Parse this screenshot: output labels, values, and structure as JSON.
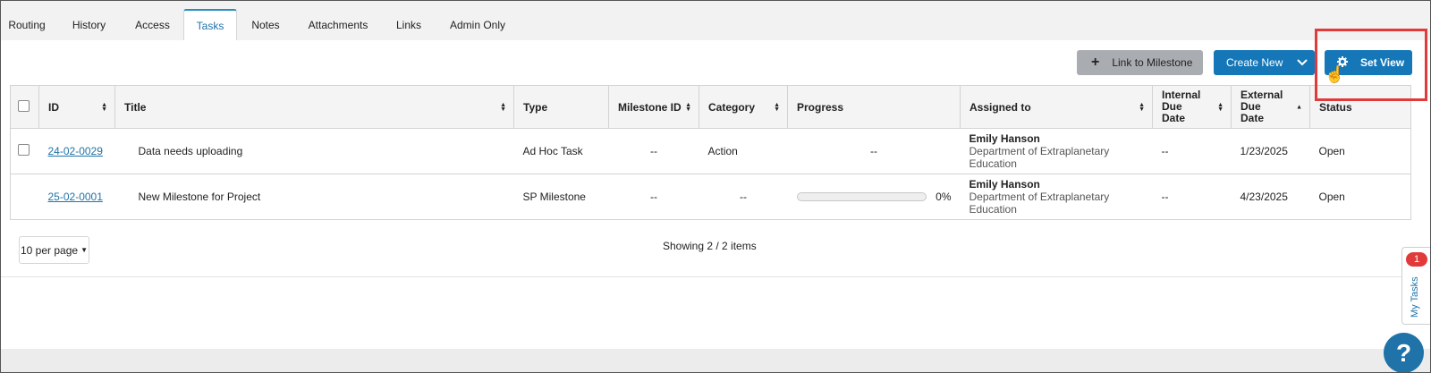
{
  "tabs": [
    {
      "label": "Routing"
    },
    {
      "label": "History"
    },
    {
      "label": "Access"
    },
    {
      "label": "Tasks"
    },
    {
      "label": "Notes"
    },
    {
      "label": "Attachments"
    },
    {
      "label": "Links"
    },
    {
      "label": "Admin Only"
    }
  ],
  "active_tab": "Tasks",
  "toolbar": {
    "link_label": "Link to Milestone",
    "create_label": "Create New",
    "setview_label": "Set View"
  },
  "table": {
    "headers": {
      "id": "ID",
      "title": "Title",
      "type": "Type",
      "milestone_id": "Milestone ID",
      "category": "Category",
      "progress": "Progress",
      "assigned": "Assigned to",
      "internal_due": "Internal Due Date",
      "external_due": "External Due Date",
      "status": "Status"
    },
    "rows": [
      {
        "id": "24-02-0029",
        "title": "Data needs uploading",
        "type": "Ad Hoc Task",
        "milestone_id": "--",
        "category": "Action",
        "progress": "--",
        "assignee_name": "Emily Hanson",
        "assignee_dept": "Department of Extraplanetary Education",
        "internal_due": "--",
        "external_due": "1/23/2025",
        "status": "Open"
      },
      {
        "id": "25-02-0001",
        "title": "New Milestone for Project",
        "type": "SP Milestone",
        "milestone_id": "--",
        "category": "--",
        "progress": "0%",
        "progress_value": 0,
        "assignee_name": "Emily Hanson",
        "assignee_dept": "Department of Extraplanetary Education",
        "internal_due": "--",
        "external_due": "4/23/2025",
        "status": "Open"
      }
    ]
  },
  "pagination": {
    "per_page_label": "10 per page",
    "showing_text": "Showing 2 / 2 items"
  },
  "side_panel": {
    "label": "My Tasks",
    "badge": "1"
  },
  "help_label": "?",
  "colors": {
    "accent": "#1577b8",
    "tab_active": "#1f73a8",
    "highlight": "#e03a3a",
    "secondary_button": "#a9acb1"
  }
}
